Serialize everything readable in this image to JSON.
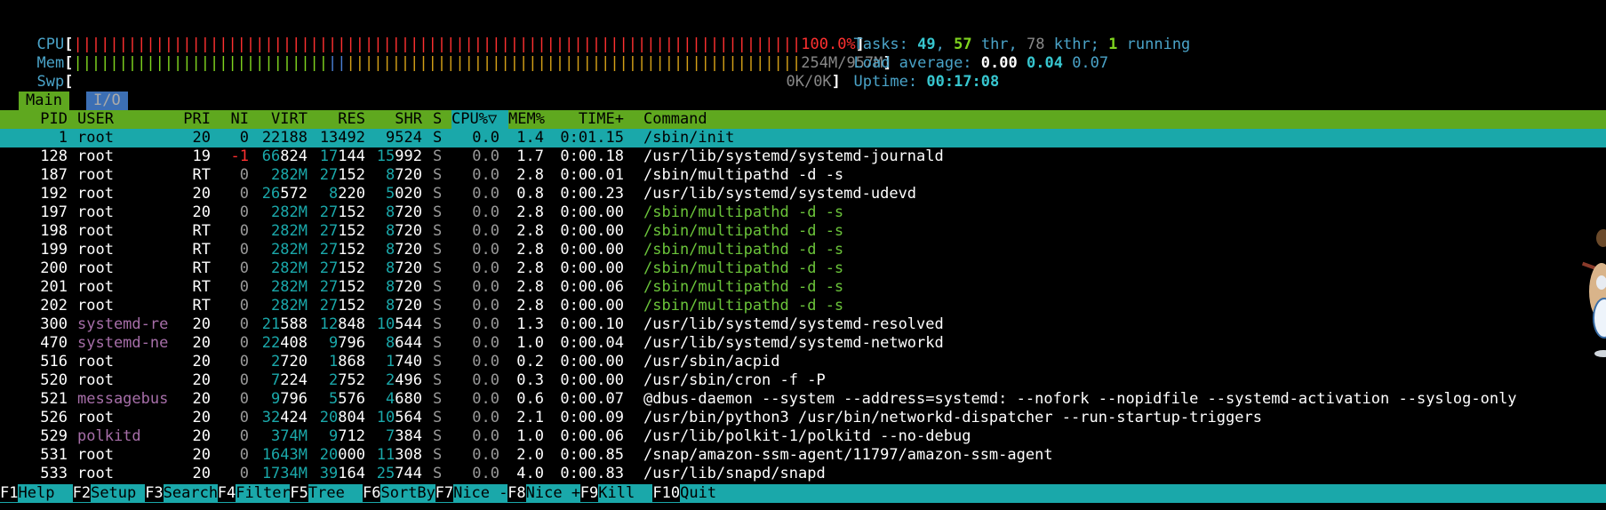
{
  "meters": {
    "cpu": {
      "label": "CPU",
      "value_text": "100.0%"
    },
    "mem": {
      "label": "Mem",
      "value_text": "254M/957M"
    },
    "swp": {
      "label": "Swp",
      "value_text": "0K/0K"
    }
  },
  "tasks": {
    "label": "Tasks: ",
    "tasks": "49",
    "sep1": ", ",
    "threads": "57",
    "thr_label": " thr, ",
    "kthr": "78",
    "kthr_label": " kthr; ",
    "running": "1",
    "running_label": " running"
  },
  "load": {
    "label": "Load average: ",
    "l1": "0.00",
    "l5": "0.04",
    "l15": "0.07"
  },
  "uptime": {
    "label": "Uptime: ",
    "value": "00:17:08"
  },
  "tabs": [
    {
      "label": "Main"
    },
    {
      "label": "I/O"
    }
  ],
  "columns": {
    "pid": "PID",
    "user": "USER",
    "pri": "PRI",
    "ni": "NI",
    "virt": "VIRT",
    "res": "RES",
    "shr": "SHR",
    "s": "S",
    "cpu": "CPU%▽",
    "mem": "MEM%",
    "time": "TIME+",
    "command": "Command"
  },
  "processes": [
    {
      "pid": "1",
      "user": "root",
      "pri": "20",
      "ni": "0",
      "virt": "22188",
      "res": "13492",
      "shr": "9524",
      "s": "S",
      "cpu": "0.0",
      "mem": "1.4",
      "time": "0:01.15",
      "command": "/sbin/init"
    },
    {
      "pid": "128",
      "user": "root",
      "pri": "19",
      "ni": "-1",
      "virt": "66824",
      "res": "17144",
      "shr": "15992",
      "s": "S",
      "cpu": "0.0",
      "mem": "1.7",
      "time": "0:00.18",
      "command": "/usr/lib/systemd/systemd-journald"
    },
    {
      "pid": "187",
      "user": "root",
      "pri": "RT",
      "ni": "0",
      "virt": "282M",
      "res": "27152",
      "shr": "8720",
      "s": "S",
      "cpu": "0.0",
      "mem": "2.8",
      "time": "0:00.01",
      "command": "/sbin/multipathd -d -s"
    },
    {
      "pid": "192",
      "user": "root",
      "pri": "20",
      "ni": "0",
      "virt": "26572",
      "res": "8220",
      "shr": "5020",
      "s": "S",
      "cpu": "0.0",
      "mem": "0.8",
      "time": "0:00.23",
      "command": "/usr/lib/systemd/systemd-udevd"
    },
    {
      "pid": "197",
      "user": "root",
      "pri": "20",
      "ni": "0",
      "virt": "282M",
      "res": "27152",
      "shr": "8720",
      "s": "S",
      "cpu": "0.0",
      "mem": "2.8",
      "time": "0:00.00",
      "command": "/sbin/multipathd -d -s"
    },
    {
      "pid": "198",
      "user": "root",
      "pri": "RT",
      "ni": "0",
      "virt": "282M",
      "res": "27152",
      "shr": "8720",
      "s": "S",
      "cpu": "0.0",
      "mem": "2.8",
      "time": "0:00.00",
      "command": "/sbin/multipathd -d -s"
    },
    {
      "pid": "199",
      "user": "root",
      "pri": "RT",
      "ni": "0",
      "virt": "282M",
      "res": "27152",
      "shr": "8720",
      "s": "S",
      "cpu": "0.0",
      "mem": "2.8",
      "time": "0:00.00",
      "command": "/sbin/multipathd -d -s"
    },
    {
      "pid": "200",
      "user": "root",
      "pri": "RT",
      "ni": "0",
      "virt": "282M",
      "res": "27152",
      "shr": "8720",
      "s": "S",
      "cpu": "0.0",
      "mem": "2.8",
      "time": "0:00.00",
      "command": "/sbin/multipathd -d -s"
    },
    {
      "pid": "201",
      "user": "root",
      "pri": "RT",
      "ni": "0",
      "virt": "282M",
      "res": "27152",
      "shr": "8720",
      "s": "S",
      "cpu": "0.0",
      "mem": "2.8",
      "time": "0:00.06",
      "command": "/sbin/multipathd -d -s"
    },
    {
      "pid": "202",
      "user": "root",
      "pri": "RT",
      "ni": "0",
      "virt": "282M",
      "res": "27152",
      "shr": "8720",
      "s": "S",
      "cpu": "0.0",
      "mem": "2.8",
      "time": "0:00.00",
      "command": "/sbin/multipathd -d -s"
    },
    {
      "pid": "300",
      "user": "systemd-re",
      "pri": "20",
      "ni": "0",
      "virt": "21588",
      "res": "12848",
      "shr": "10544",
      "s": "S",
      "cpu": "0.0",
      "mem": "1.3",
      "time": "0:00.10",
      "command": "/usr/lib/systemd/systemd-resolved"
    },
    {
      "pid": "470",
      "user": "systemd-ne",
      "pri": "20",
      "ni": "0",
      "virt": "22408",
      "res": "9796",
      "shr": "8644",
      "s": "S",
      "cpu": "0.0",
      "mem": "1.0",
      "time": "0:00.04",
      "command": "/usr/lib/systemd/systemd-networkd"
    },
    {
      "pid": "516",
      "user": "root",
      "pri": "20",
      "ni": "0",
      "virt": "2720",
      "res": "1868",
      "shr": "1740",
      "s": "S",
      "cpu": "0.0",
      "mem": "0.2",
      "time": "0:00.00",
      "command": "/usr/sbin/acpid"
    },
    {
      "pid": "520",
      "user": "root",
      "pri": "20",
      "ni": "0",
      "virt": "7224",
      "res": "2752",
      "shr": "2496",
      "s": "S",
      "cpu": "0.0",
      "mem": "0.3",
      "time": "0:00.00",
      "command": "/usr/sbin/cron -f -P"
    },
    {
      "pid": "521",
      "user": "messagebus",
      "pri": "20",
      "ni": "0",
      "virt": "9796",
      "res": "5576",
      "shr": "4680",
      "s": "S",
      "cpu": "0.0",
      "mem": "0.6",
      "time": "0:00.07",
      "command": "@dbus-daemon --system --address=systemd: --nofork --nopidfile --systemd-activation --syslog-only"
    },
    {
      "pid": "526",
      "user": "root",
      "pri": "20",
      "ni": "0",
      "virt": "32424",
      "res": "20804",
      "shr": "10564",
      "s": "S",
      "cpu": "0.0",
      "mem": "2.1",
      "time": "0:00.09",
      "command": "/usr/bin/python3 /usr/bin/networkd-dispatcher --run-startup-triggers"
    },
    {
      "pid": "529",
      "user": "polkitd",
      "pri": "20",
      "ni": "0",
      "virt": "374M",
      "res": "9712",
      "shr": "7384",
      "s": "S",
      "cpu": "0.0",
      "mem": "1.0",
      "time": "0:00.06",
      "command": "/usr/lib/polkit-1/polkitd --no-debug"
    },
    {
      "pid": "531",
      "user": "root",
      "pri": "20",
      "ni": "0",
      "virt": "1643M",
      "res": "20000",
      "shr": "11308",
      "s": "S",
      "cpu": "0.0",
      "mem": "2.0",
      "time": "0:00.85",
      "command": "/snap/amazon-ssm-agent/11797/amazon-ssm-agent"
    },
    {
      "pid": "533",
      "user": "root",
      "pri": "20",
      "ni": "0",
      "virt": "1734M",
      "res": "39164",
      "shr": "25744",
      "s": "S",
      "cpu": "0.0",
      "mem": "4.0",
      "time": "0:00.83",
      "command": "/usr/lib/snapd/snapd"
    }
  ],
  "fkeys": [
    {
      "key": "F1",
      "label": "Help  "
    },
    {
      "key": "F2",
      "label": "Setup "
    },
    {
      "key": "F3",
      "label": "Search"
    },
    {
      "key": "F4",
      "label": "Filter"
    },
    {
      "key": "F5",
      "label": "Tree  "
    },
    {
      "key": "F6",
      "label": "SortBy"
    },
    {
      "key": "F7",
      "label": "Nice -"
    },
    {
      "key": "F8",
      "label": "Nice +"
    },
    {
      "key": "F9",
      "label": "Kill  "
    },
    {
      "key": "F10",
      "label": "Quit"
    }
  ],
  "colors": {
    "header_bg": "#5fa81f",
    "selection_bg": "#1aa8aa",
    "meter_red": "#ff3030",
    "meter_green": "#7fd41f",
    "label_blue": "#4aa3c8"
  }
}
